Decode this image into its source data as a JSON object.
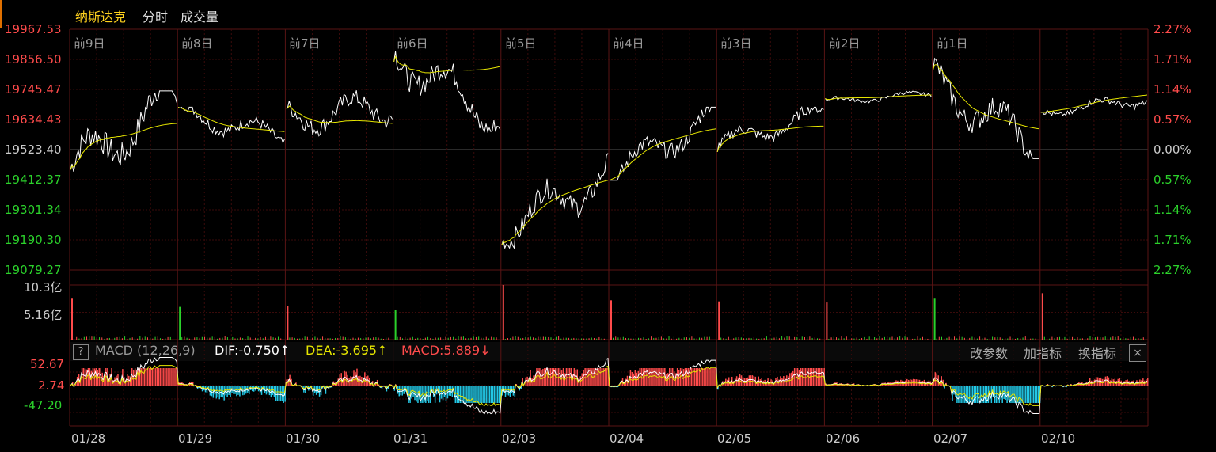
{
  "header": {
    "index_name": "纳斯达克",
    "tab_timeshare": "分时",
    "tab_volume": "成交量"
  },
  "price_axis": {
    "left_labels": [
      "19967.53",
      "19856.50",
      "19745.47",
      "19634.43",
      "19523.40",
      "19412.37",
      "19301.34",
      "19190.30",
      "19079.27"
    ],
    "right_labels": [
      "2.27%",
      "1.71%",
      "1.14%",
      "0.57%",
      "0.00%",
      "0.57%",
      "1.14%",
      "1.71%",
      "2.27%"
    ]
  },
  "volume_axis": {
    "labels": [
      "10.3亿",
      "5.16亿"
    ]
  },
  "macd": {
    "help": "?",
    "name": "MACD (12,26,9)",
    "dif": "DIF:-0.750↑",
    "dea": "DEA:-3.695↑",
    "macd_value": "MACD:5.889↓",
    "axis_labels": [
      "52.67",
      "2.74",
      "-47.20"
    ],
    "buttons": [
      "改参数",
      "加指标",
      "换指标"
    ],
    "close": "×"
  },
  "day_labels": [
    "前9日",
    "前8日",
    "前7日",
    "前6日",
    "前5日",
    "前4日",
    "前3日",
    "前2日",
    "前1日"
  ],
  "dates": [
    "01/28",
    "01/29",
    "01/30",
    "01/31",
    "02/03",
    "02/04",
    "02/05",
    "02/06",
    "02/07",
    "02/10"
  ],
  "colors": {
    "up": "#ff4b4b",
    "down": "#2bd12b",
    "neutral": "#cccccc",
    "price_line": "#ffffff",
    "avg_line": "#e6e600",
    "dif_line": "#ffffff",
    "dea_line": "#e6e600",
    "macd_up": "#ff4b4b",
    "macd_down": "#23c8e6",
    "grid": "#3a0a0a",
    "separator": "#5a1414"
  },
  "chart_data": {
    "type": "line",
    "title": "纳斯达克",
    "prev_close": 19523.4,
    "ylim": [
      19079.27,
      19967.53
    ],
    "days": [
      {
        "date": "01/28",
        "open": 19450,
        "close": 19720,
        "high": 19740,
        "low": 19300,
        "avg_end": 19620,
        "volume_spike": 0.75
      },
      {
        "date": "01/29",
        "open": 19660,
        "close": 19570,
        "high": 19680,
        "low": 19500,
        "avg_end": 19590,
        "volume_spike": 0.6
      },
      {
        "date": "01/30",
        "open": 19640,
        "close": 19680,
        "high": 19770,
        "low": 19490,
        "avg_end": 19620,
        "volume_spike": 0.62
      },
      {
        "date": "01/31",
        "open": 19880,
        "close": 19630,
        "high": 19970,
        "low": 19590,
        "avg_end": 19830,
        "volume_spike": 0.55
      },
      {
        "date": "02/03",
        "open": 19230,
        "close": 19430,
        "high": 19510,
        "low": 19160,
        "avg_end": 19410,
        "volume_spike": 1.0
      },
      {
        "date": "02/04",
        "open": 19420,
        "close": 19660,
        "high": 19680,
        "low": 19410,
        "avg_end": 19600,
        "volume_spike": 0.72
      },
      {
        "date": "02/05",
        "open": 19540,
        "close": 19660,
        "high": 19680,
        "low": 19500,
        "avg_end": 19610,
        "volume_spike": 0.7
      },
      {
        "date": "02/06",
        "open": 19700,
        "close": 19730,
        "high": 19750,
        "low": 19690,
        "avg_end": 19725,
        "volume_spike": 0.68
      },
      {
        "date": "02/07",
        "open": 19780,
        "close": 19520,
        "high": 19860,
        "low": 19490,
        "avg_end": 19600,
        "volume_spike": 0.75
      },
      {
        "date": "02/10",
        "open": 19660,
        "close": 19710,
        "high": 19760,
        "low": 19650,
        "avg_end": 19725,
        "volume_spike": 0.85
      }
    ]
  }
}
